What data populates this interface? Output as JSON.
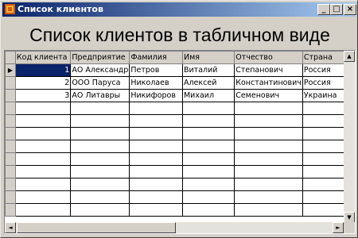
{
  "window": {
    "title": "Список клиентов"
  },
  "heading": "Список клиентов в табличном виде",
  "grid": {
    "columns": [
      "Код клиента",
      "Предприятие",
      "Фамилия",
      "Имя",
      "Отчество",
      "Страна"
    ],
    "rows": [
      [
        "1",
        "АО Александр",
        "Петров",
        "Виталий",
        "Степанович",
        "Россия"
      ],
      [
        "2",
        "ООО Паруса",
        "Николаев",
        "Алексей",
        "Константинович",
        "Россия"
      ],
      [
        "3",
        "АО Литавры",
        "Никифоров",
        "Михаил",
        "Семенович",
        "Украина"
      ]
    ],
    "selected_row": 0
  }
}
